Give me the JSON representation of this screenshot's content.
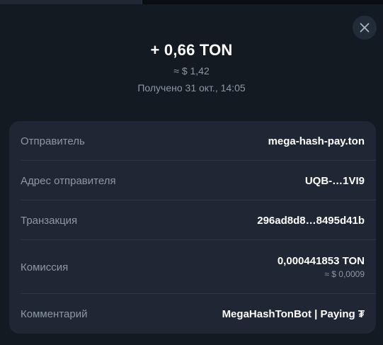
{
  "transaction": {
    "amount": "+ 0,66 TON",
    "fiat_value": "≈ $ 1,42",
    "received_text": "Получено 31 окт., 14:05"
  },
  "details": {
    "sender_label": "Отправитель",
    "sender_value": "mega-hash-pay.ton",
    "address_label": "Адрес отправителя",
    "address_value": "UQB-…1VI9",
    "tx_label": "Транзакция",
    "tx_value": "296ad8d8…8495d41b",
    "fee_label": "Комиссия",
    "fee_value": "0,000441853 TON",
    "fee_fiat": "≈ $ 0,0009",
    "comment_label": "Комментарий",
    "comment_value": "MegaHashTonBot | Paying ₮"
  },
  "icons": {
    "close": "close-icon"
  },
  "colors": {
    "background": "#131a22",
    "card": "#1e2733",
    "muted_text": "#8d98a6",
    "primary_text": "#ffffff"
  }
}
